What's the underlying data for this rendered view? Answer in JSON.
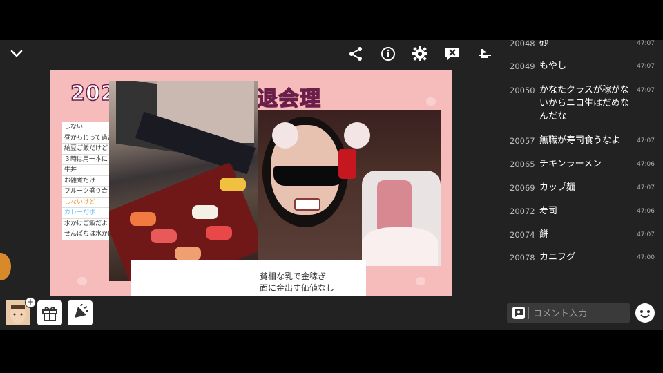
{
  "stage": {
    "title_left": "202",
    "title_right": "退会理由TOP10",
    "list_items": [
      {
        "text": "しない",
        "cls": ""
      },
      {
        "text": "昼からじって過ご",
        "cls": ""
      },
      {
        "text": "納豆ご飯だけど",
        "cls": ""
      },
      {
        "text": "３時は用一本に",
        "cls": ""
      },
      {
        "text": "牛丼",
        "cls": ""
      },
      {
        "text": "お雑煮だけ",
        "cls": ""
      },
      {
        "text": "フルーツ盛り合",
        "cls": ""
      },
      {
        "text": "しないけど",
        "cls": "or"
      },
      {
        "text": "カレーだボ",
        "cls": "bl"
      },
      {
        "text": "水かけご飯だよ",
        "cls": ""
      },
      {
        "text": "せんぱちは水かけ",
        "cls": ""
      }
    ],
    "caption_line1": "貧相な乳で金稼ぎ",
    "caption_line2": "面に金出す価値なし"
  },
  "chat": {
    "rows": [
      {
        "num": "20048",
        "text": "砂",
        "time": "47:07"
      },
      {
        "num": "20049",
        "text": "もやし",
        "time": "47:07"
      },
      {
        "num": "20050",
        "text": "かなたクラスが稼がないからニコ生はだめなんだな",
        "time": "47:07"
      },
      {
        "num": "20057",
        "text": "無職が寿司食うなよ",
        "time": "47:07"
      },
      {
        "num": "20065",
        "text": "チキンラーメン",
        "time": "47:06"
      },
      {
        "num": "20069",
        "text": "カップ麺",
        "time": "47:07"
      },
      {
        "num": "20072",
        "text": "寿司",
        "time": "47:06"
      },
      {
        "num": "20074",
        "text": "餅",
        "time": "47:07"
      },
      {
        "num": "20078",
        "text": "カニフグ",
        "time": "47:00"
      }
    ]
  },
  "comment": {
    "placeholder": "コメント入力"
  },
  "colors": {
    "background": "#222222",
    "stage_bg": "#f6bcbc",
    "title_stroke": "#6a1f4a"
  }
}
